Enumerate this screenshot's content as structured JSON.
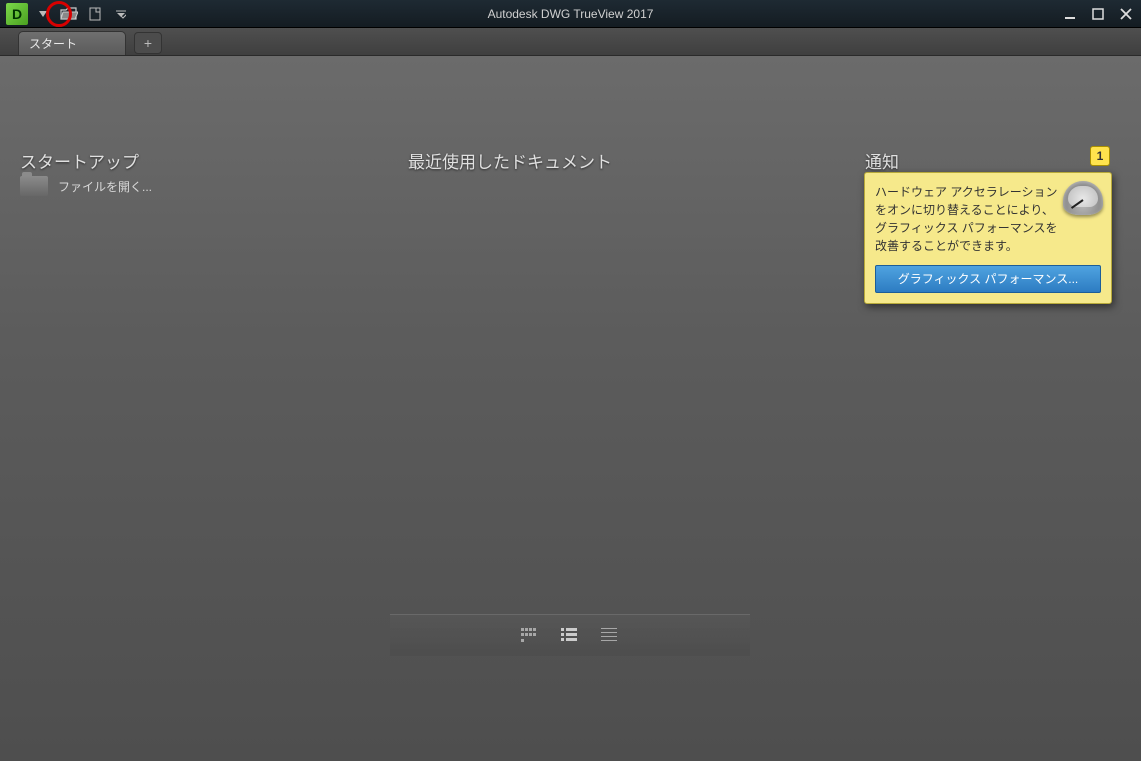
{
  "app": {
    "title": "Autodesk DWG TrueView 2017"
  },
  "tabs": {
    "start_label": "スタート"
  },
  "startup": {
    "title": "スタートアップ",
    "open_file_label": "ファイルを開く..."
  },
  "recent": {
    "title": "最近使用したドキュメント"
  },
  "notify": {
    "title": "通知",
    "badge_count": "1",
    "message": "ハードウェア アクセラレーションをオンに切り替えることにより、グラフィックス パフォーマンスを改善することができます。",
    "button_label": "グラフィックス パフォーマンス..."
  }
}
